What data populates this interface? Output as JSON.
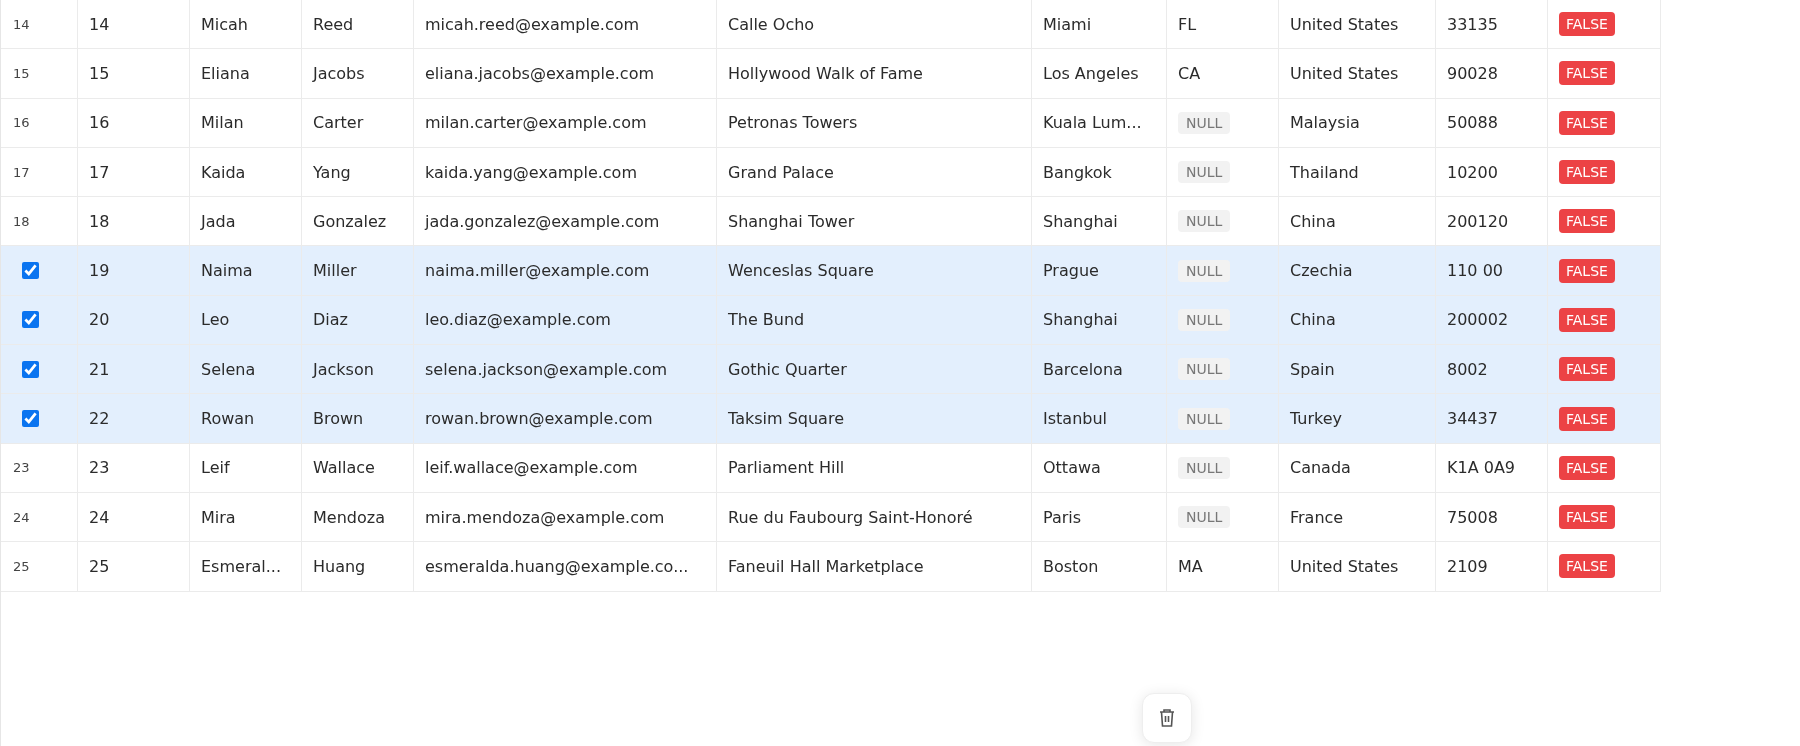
{
  "table": {
    "rows": [
      {
        "row_number": "14",
        "selected": false,
        "id": "14",
        "first_name": "Micah",
        "last_name": "Reed",
        "email": "micah.reed@example.com",
        "address": "Calle Ocho",
        "city": "Miami",
        "state": {
          "kind": "value",
          "text": "FL"
        },
        "country": "United States",
        "zip": "33135",
        "flag": {
          "kind": "false",
          "text": "FALSE"
        }
      },
      {
        "row_number": "15",
        "selected": false,
        "id": "15",
        "first_name": "Eliana",
        "last_name": "Jacobs",
        "email": "eliana.jacobs@example.com",
        "address": "Hollywood Walk of Fame",
        "city": "Los Angeles",
        "state": {
          "kind": "value",
          "text": "CA"
        },
        "country": "United States",
        "zip": "90028",
        "flag": {
          "kind": "false",
          "text": "FALSE"
        }
      },
      {
        "row_number": "16",
        "selected": false,
        "id": "16",
        "first_name": "Milan",
        "last_name": "Carter",
        "email": "milan.carter@example.com",
        "address": "Petronas Towers",
        "city": "Kuala Lum...",
        "state": {
          "kind": "null",
          "text": "NULL"
        },
        "country": "Malaysia",
        "zip": "50088",
        "flag": {
          "kind": "false",
          "text": "FALSE"
        }
      },
      {
        "row_number": "17",
        "selected": false,
        "id": "17",
        "first_name": "Kaida",
        "last_name": "Yang",
        "email": "kaida.yang@example.com",
        "address": "Grand Palace",
        "city": "Bangkok",
        "state": {
          "kind": "null",
          "text": "NULL"
        },
        "country": "Thailand",
        "zip": "10200",
        "flag": {
          "kind": "false",
          "text": "FALSE"
        }
      },
      {
        "row_number": "18",
        "selected": false,
        "id": "18",
        "first_name": "Jada",
        "last_name": "Gonzalez",
        "email": "jada.gonzalez@example.com",
        "address": "Shanghai Tower",
        "city": "Shanghai",
        "state": {
          "kind": "null",
          "text": "NULL"
        },
        "country": "China",
        "zip": "200120",
        "flag": {
          "kind": "false",
          "text": "FALSE"
        }
      },
      {
        "selected": true,
        "id": "19",
        "first_name": "Naima",
        "last_name": "Miller",
        "email": "naima.miller@example.com",
        "address": "Wenceslas Square",
        "city": "Prague",
        "state": {
          "kind": "null",
          "text": "NULL"
        },
        "country": "Czechia",
        "zip": "110 00",
        "flag": {
          "kind": "false",
          "text": "FALSE"
        }
      },
      {
        "selected": true,
        "id": "20",
        "first_name": "Leo",
        "last_name": "Diaz",
        "email": "leo.diaz@example.com",
        "address": "The Bund",
        "city": "Shanghai",
        "state": {
          "kind": "null",
          "text": "NULL"
        },
        "country": "China",
        "zip": "200002",
        "flag": {
          "kind": "false",
          "text": "FALSE"
        }
      },
      {
        "selected": true,
        "id": "21",
        "first_name": "Selena",
        "last_name": "Jackson",
        "email": "selena.jackson@example.com",
        "address": "Gothic Quarter",
        "city": "Barcelona",
        "state": {
          "kind": "null",
          "text": "NULL"
        },
        "country": "Spain",
        "zip": "8002",
        "flag": {
          "kind": "false",
          "text": "FALSE"
        }
      },
      {
        "selected": true,
        "id": "22",
        "first_name": "Rowan",
        "last_name": "Brown",
        "email": "rowan.brown@example.com",
        "address": "Taksim Square",
        "city": "Istanbul",
        "state": {
          "kind": "null",
          "text": "NULL"
        },
        "country": "Turkey",
        "zip": "34437",
        "flag": {
          "kind": "false",
          "text": "FALSE"
        }
      },
      {
        "row_number": "23",
        "selected": false,
        "id": "23",
        "first_name": "Leif",
        "last_name": "Wallace",
        "email": "leif.wallace@example.com",
        "address": "Parliament Hill",
        "city": "Ottawa",
        "state": {
          "kind": "null",
          "text": "NULL"
        },
        "country": "Canada",
        "zip": "K1A 0A9",
        "flag": {
          "kind": "false",
          "text": "FALSE"
        }
      },
      {
        "row_number": "24",
        "selected": false,
        "id": "24",
        "first_name": "Mira",
        "last_name": "Mendoza",
        "email": "mira.mendoza@example.com",
        "address": "Rue du Faubourg Saint-Honoré",
        "city": "Paris",
        "state": {
          "kind": "null",
          "text": "NULL"
        },
        "country": "France",
        "zip": "75008",
        "flag": {
          "kind": "false",
          "text": "FALSE"
        }
      },
      {
        "row_number": "25",
        "selected": false,
        "id": "25",
        "first_name": "Esmeral...",
        "last_name": "Huang",
        "email": "esmeralda.huang@example.co...",
        "address": "Faneuil Hall Marketplace",
        "city": "Boston",
        "state": {
          "kind": "value",
          "text": "MA"
        },
        "country": "United States",
        "zip": "2109",
        "flag": {
          "kind": "false",
          "text": "FALSE"
        }
      }
    ]
  }
}
